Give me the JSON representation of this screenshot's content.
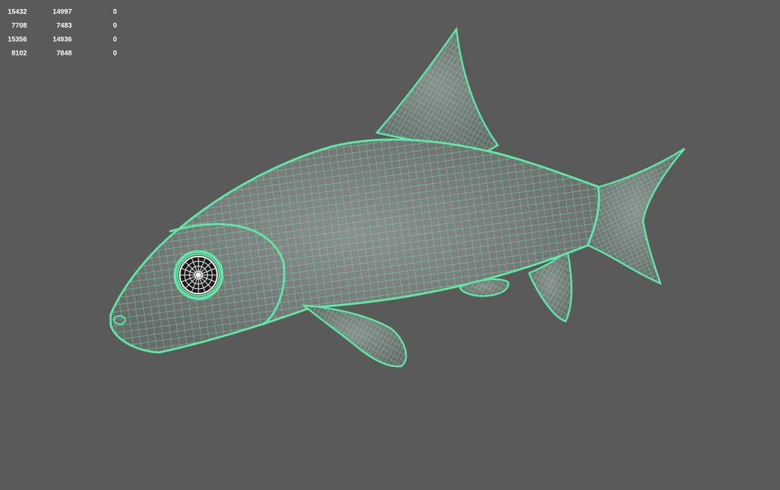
{
  "viewport": {
    "background_color": "#5a5a5a",
    "wireframe_color": "#5fe8a8",
    "selected_color": "#ffffff"
  },
  "hud": {
    "rows": [
      [
        "15432",
        "14997",
        "0"
      ],
      [
        "7708",
        "7483",
        "0"
      ],
      [
        "15356",
        "14936",
        "0"
      ],
      [
        "8102",
        "7848",
        "0"
      ]
    ]
  },
  "model": {
    "icon": "fish-wireframe-mesh"
  }
}
